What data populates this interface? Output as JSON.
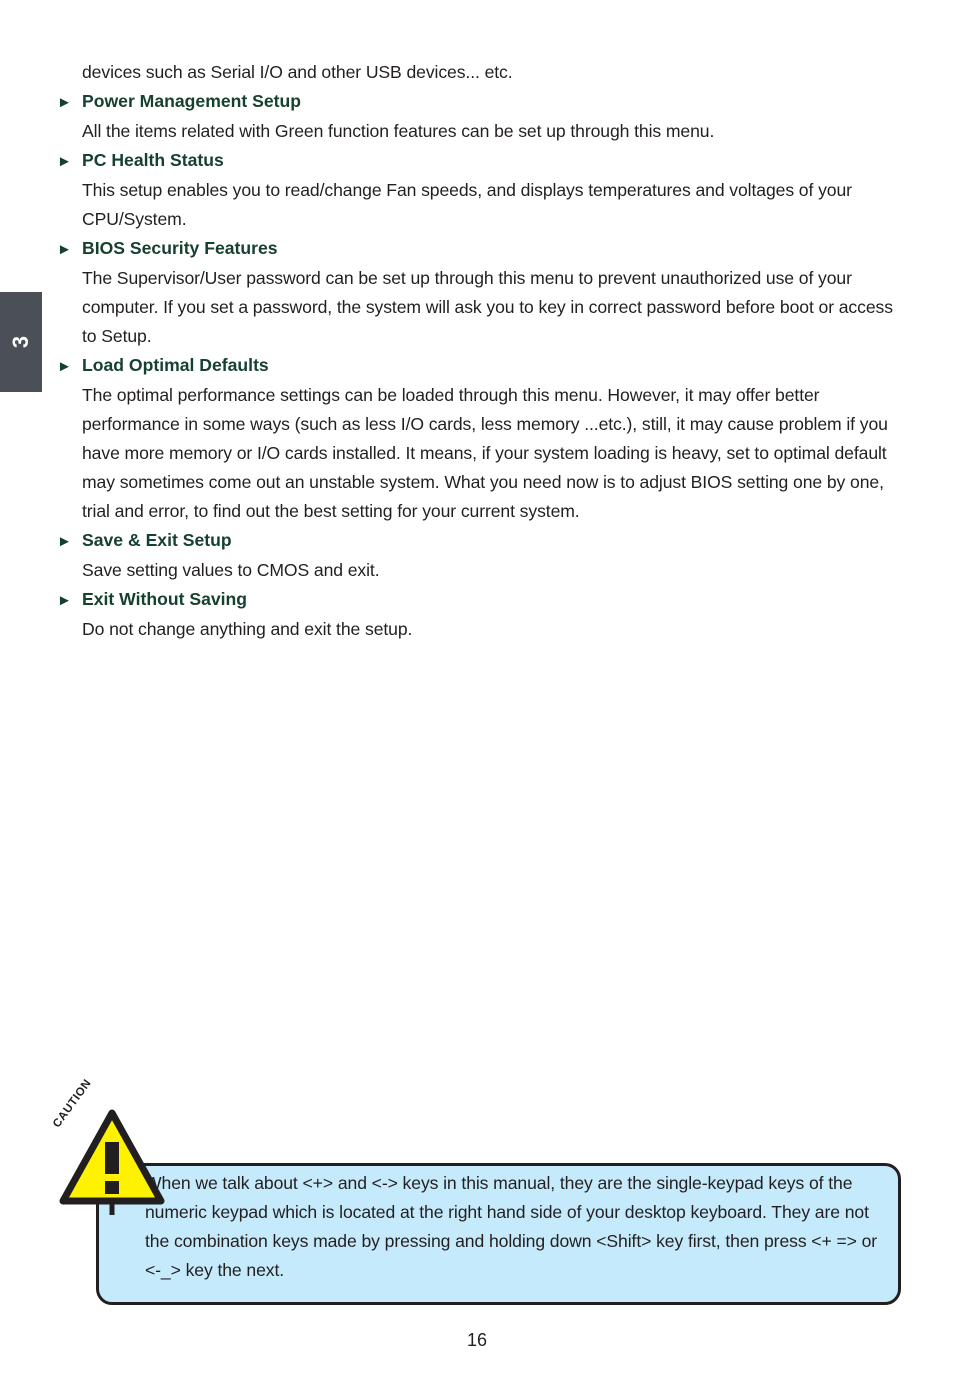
{
  "page": {
    "number": "16",
    "chapter_tab": "3"
  },
  "content": {
    "intro_line": "devices such as Serial I/O and other USB devices... etc.",
    "bullet_glyph": "►",
    "sections": [
      {
        "heading": "Power Management Setup",
        "body": "All the items related with Green function features can be set up through this menu."
      },
      {
        "heading": "PC Health Status",
        "body": "This setup enables you to read/change Fan speeds, and displays temperatures and voltages of your CPU/System."
      },
      {
        "heading": "BIOS Security Features",
        "body": "The Supervisor/User password can be set up through this menu to prevent unauthorized use of your computer. If you set a password, the system will ask you to key in correct password before boot or access to Setup."
      },
      {
        "heading": "Load Optimal Defaults",
        "body": "The optimal performance settings can be loaded through this menu. However, it may offer better performance in some ways (such as less I/O cards, less memory ...etc.), still, it may cause problem if you have more memory or I/O cards installed. It means, if your system loading is heavy, set to optimal default may sometimes come out an unstable system. What you need now is to adjust BIOS setting one by one, trial and error, to find out the best setting for your current system."
      },
      {
        "heading": "Save & Exit Setup",
        "body": "Save setting values to CMOS and exit."
      },
      {
        "heading": "Exit Without Saving",
        "body": "Do not change anything and exit the setup."
      }
    ]
  },
  "caution": {
    "label": "CAUTION",
    "mark": "!",
    "text": "When we talk about <+> and <-> keys in this manual, they are the single-keypad keys of the numeric keypad which is located at the right hand side of your desktop keyboard. They are not the combination keys made by pressing and holding down <Shift> key first, then press <+ => or <-_> key the next."
  },
  "colors": {
    "heading_green": "#17412f",
    "body_black": "#231f20",
    "tab_gray": "#4b4f58",
    "caution_fill": "#c5eafb",
    "triangle_yellow": "#fff200"
  }
}
